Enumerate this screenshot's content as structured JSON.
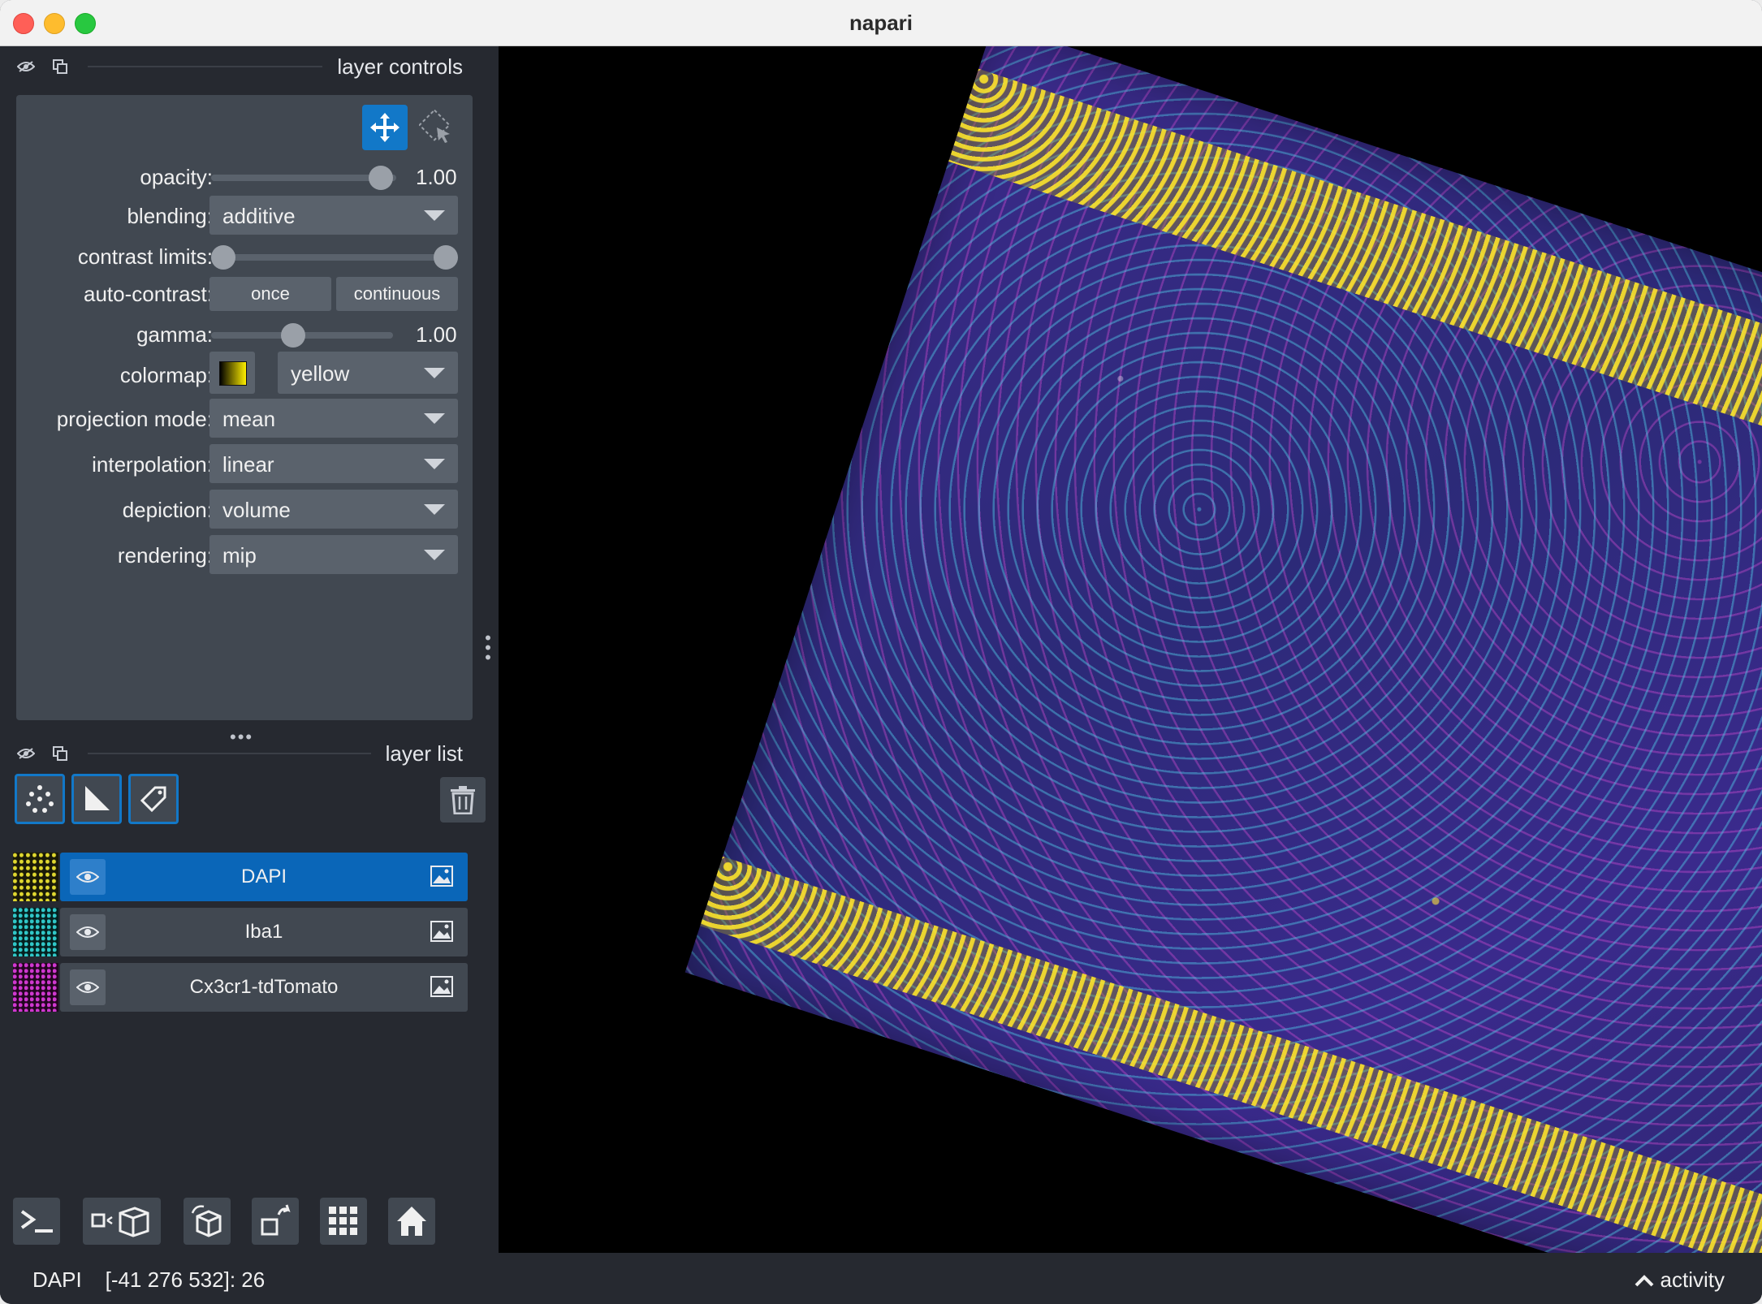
{
  "window": {
    "title": "napari"
  },
  "layer_controls": {
    "title": "layer controls",
    "opacity": {
      "label": "opacity:",
      "value": "1.00",
      "level": 1.0
    },
    "blending": {
      "label": "blending:",
      "value": "additive"
    },
    "contrast_limits": {
      "label": "contrast limits:"
    },
    "auto_contrast": {
      "label": "auto-contrast:",
      "once": "once",
      "continuous": "continuous"
    },
    "gamma": {
      "label": "gamma:",
      "value": "1.00"
    },
    "colormap": {
      "label": "colormap:",
      "value": "yellow"
    },
    "projection_mode": {
      "label": "projection mode:",
      "value": "mean"
    },
    "interpolation": {
      "label": "interpolation:",
      "value": "linear"
    },
    "depiction": {
      "label": "depiction:",
      "value": "volume"
    },
    "rendering": {
      "label": "rendering:",
      "value": "mip"
    }
  },
  "layer_list": {
    "title": "layer list",
    "layers": [
      {
        "name": "DAPI",
        "selected": true,
        "color": "#e6e040"
      },
      {
        "name": "Iba1",
        "selected": false,
        "color": "#3ad0d0"
      },
      {
        "name": "Cx3cr1-tdTomato",
        "selected": false,
        "color": "#d040d8"
      }
    ]
  },
  "status": {
    "layer": "DAPI",
    "coords": "[-41 276 532]: 26",
    "activity": "activity"
  },
  "colors": {
    "accent": "#1278c8",
    "panel": "#262930",
    "control": "#414851",
    "widget": "#5a626c"
  }
}
